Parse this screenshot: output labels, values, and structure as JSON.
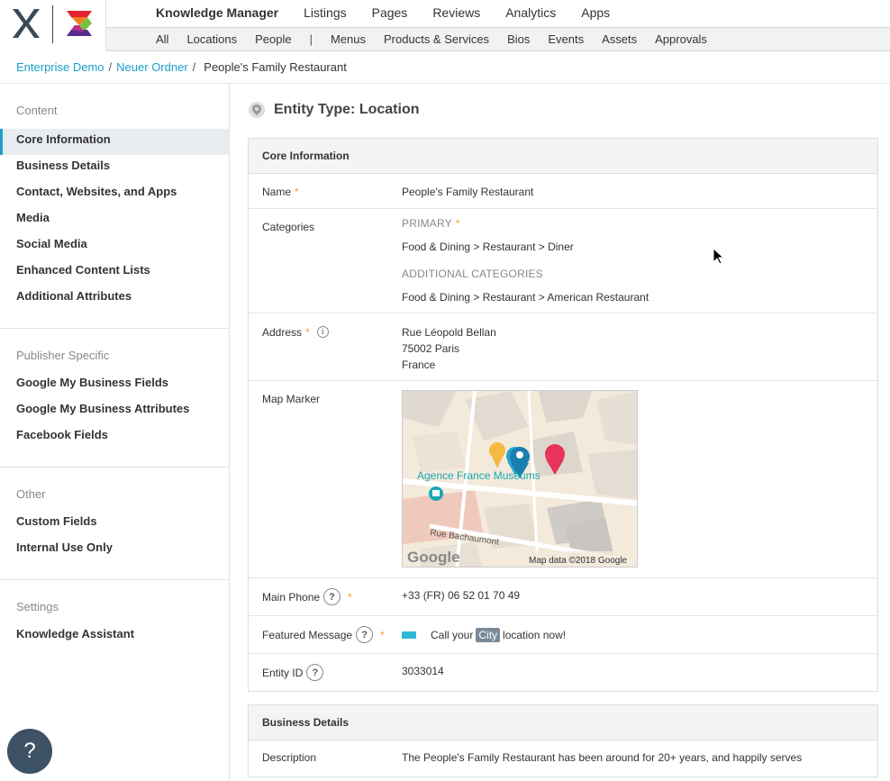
{
  "nav": {
    "main": [
      "Knowledge Manager",
      "Listings",
      "Pages",
      "Reviews",
      "Analytics",
      "Apps"
    ],
    "sub": [
      "All",
      "Locations",
      "People",
      "Menus",
      "Products & Services",
      "Bios",
      "Events",
      "Assets",
      "Approvals"
    ],
    "sub_separator": "|"
  },
  "breadcrumb": {
    "items": [
      "Enterprise Demo",
      "Neuer Ordner"
    ],
    "separator": "/",
    "current": "People's Family Restaurant"
  },
  "sidebar": {
    "content_heading": "Content",
    "content_items": [
      "Core Information",
      "Business Details",
      "Contact, Websites, and Apps",
      "Media",
      "Social Media",
      "Enhanced Content Lists",
      "Additional Attributes"
    ],
    "publisher_heading": "Publisher Specific",
    "publisher_items": [
      "Google My Business Fields",
      "Google My Business Attributes",
      "Facebook Fields"
    ],
    "other_heading": "Other",
    "other_items": [
      "Custom Fields",
      "Internal Use Only"
    ],
    "settings_heading": "Settings",
    "settings_items": [
      "Knowledge Assistant"
    ]
  },
  "entity": {
    "title": "Entity Type: Location"
  },
  "core": {
    "heading": "Core Information",
    "name_label": "Name",
    "name_value": "People's Family Restaurant",
    "categories_label": "Categories",
    "primary_label": "PRIMARY",
    "primary_value": "Food & Dining > Restaurant > Diner",
    "additional_label": "ADDITIONAL CATEGORIES",
    "additional_value": "Food & Dining > Restaurant > American Restaurant",
    "address_label": "Address",
    "address_line1": "Rue Léopold Bellan",
    "address_line2": "75002 Paris",
    "address_line3": "France",
    "map_label": "Map Marker",
    "map_place": "Agence France Muséums",
    "map_street": "Rue Bachaumont",
    "map_brand": "Google",
    "map_credit": "Map data ©2018 Google",
    "phone_label": "Main Phone",
    "phone_value": "+33 (FR) 06 52 01 70 49",
    "featured_label": "Featured Message",
    "featured_before": "Call your",
    "featured_tag": "City",
    "featured_after": "location now!",
    "entity_id_label": "Entity ID",
    "entity_id_value": "3033014"
  },
  "business": {
    "heading": "Business Details",
    "description_label": "Description",
    "description_value": "The People's Family Restaurant has been around for 20+ years, and happily serves"
  },
  "help_fab": "?",
  "colors": {
    "accent": "#1ba0c8",
    "required": "#f5a623",
    "fab": "#3d5365"
  }
}
